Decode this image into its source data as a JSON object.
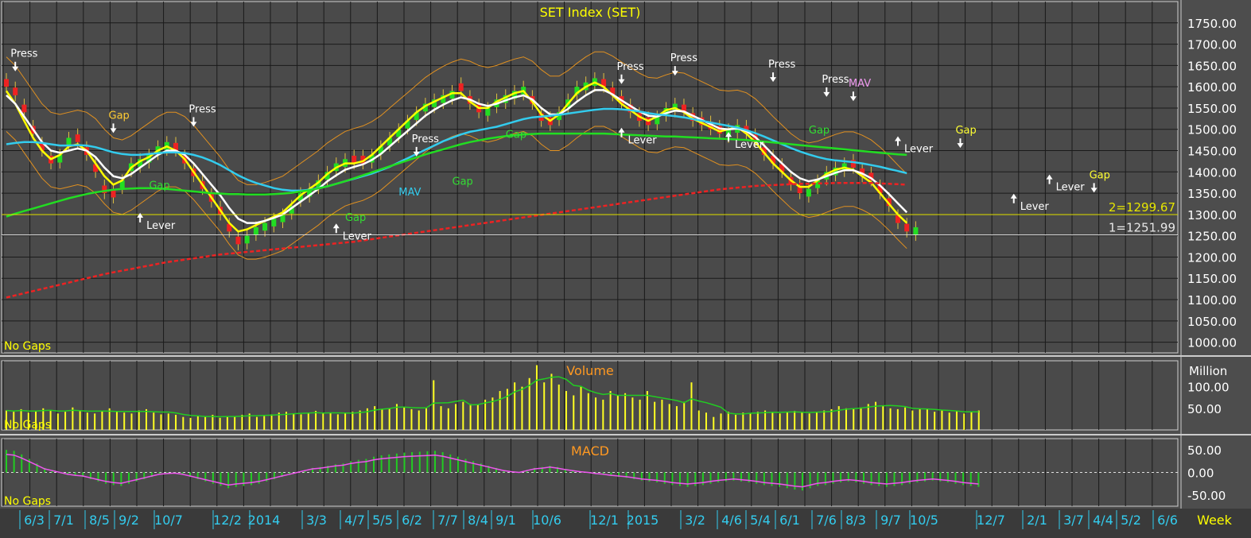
{
  "chart_data": {
    "type": "candlestick",
    "title": "SET Index (SET)",
    "no_gaps_label": "No Gaps",
    "timeframe_label": "Week",
    "x_tick_labels": [
      "6/3",
      "7/1",
      "8/5",
      "9/2",
      "10/7",
      "12/2",
      "2014",
      "3/3",
      "4/7",
      "5/5",
      "6/2",
      "7/7",
      "8/4",
      "9/1",
      "10/6",
      "12/1",
      "2015",
      "3/2",
      "4/6",
      "5/4",
      "6/1",
      "7/6",
      "8/3",
      "9/7",
      "10/5",
      "12/7",
      "2/1",
      "3/7",
      "4/4",
      "5/2",
      "6/6"
    ],
    "price_axis": {
      "ylim": [
        975,
        1800
      ],
      "ticks": [
        "1750.00",
        "1700.00",
        "1650.00",
        "1600.00",
        "1550.00",
        "1500.00",
        "1450.00",
        "1400.00",
        "1350.00",
        "1300.00",
        "1250.00",
        "1200.00",
        "1150.00",
        "1100.00",
        "1050.00",
        "1000.00"
      ]
    },
    "price_lines": [
      {
        "label": "2=1299.67",
        "value": 1299.67,
        "color": "#e6e600"
      },
      {
        "label": "1=1251.99",
        "value": 1251.99,
        "color": "#e8e8e8"
      }
    ],
    "candles_close": [
      1600,
      1580,
      1540,
      1490,
      1450,
      1420,
      1440,
      1480,
      1470,
      1440,
      1400,
      1350,
      1340,
      1380,
      1420,
      1430,
      1440,
      1460,
      1470,
      1450,
      1420,
      1390,
      1360,
      1330,
      1300,
      1260,
      1230,
      1250,
      1270,
      1280,
      1290,
      1300,
      1320,
      1350,
      1360,
      1380,
      1400,
      1420,
      1430,
      1420,
      1420,
      1440,
      1460,
      1480,
      1500,
      1520,
      1540,
      1560,
      1570,
      1580,
      1590,
      1590,
      1560,
      1540,
      1550,
      1570,
      1580,
      1590,
      1600,
      1560,
      1520,
      1510,
      1540,
      1570,
      1600,
      1610,
      1620,
      1600,
      1580,
      1560,
      1540,
      1520,
      1510,
      1530,
      1550,
      1560,
      1540,
      1520,
      1510,
      1500,
      1490,
      1500,
      1510,
      1490,
      1470,
      1440,
      1420,
      1400,
      1370,
      1350,
      1360,
      1380,
      1400,
      1410,
      1420,
      1410,
      1390,
      1380,
      1350,
      1320,
      1280,
      1260,
      1270
    ],
    "candles_direction": [
      -1,
      -1,
      -1,
      -1,
      -1,
      -1,
      1,
      1,
      -1,
      -1,
      -1,
      -1,
      -1,
      1,
      1,
      1,
      1,
      1,
      1,
      -1,
      -1,
      -1,
      -1,
      -1,
      -1,
      -1,
      -1,
      1,
      1,
      1,
      1,
      1,
      1,
      1,
      1,
      1,
      1,
      1,
      1,
      -1,
      -1,
      1,
      1,
      1,
      1,
      1,
      1,
      1,
      1,
      1,
      1,
      -1,
      -1,
      -1,
      1,
      1,
      1,
      1,
      1,
      -1,
      -1,
      -1,
      1,
      1,
      1,
      1,
      1,
      -1,
      -1,
      -1,
      -1,
      -1,
      -1,
      1,
      1,
      1,
      -1,
      -1,
      -1,
      -1,
      -1,
      1,
      1,
      -1,
      -1,
      -1,
      -1,
      -1,
      -1,
      -1,
      1,
      1,
      1,
      1,
      1,
      -1,
      -1,
      -1,
      -1,
      -1,
      -1,
      -1,
      1
    ],
    "series": [
      {
        "name": "",
        "color": "#ffff00",
        "values": [
          1590,
          1560,
          1520,
          1480,
          1450,
          1430,
          1440,
          1460,
          1465,
          1450,
          1420,
          1390,
          1370,
          1380,
          1410,
          1425,
          1435,
          1450,
          1460,
          1450,
          1430,
          1400,
          1370,
          1340,
          1310,
          1280,
          1260,
          1265,
          1275,
          1285,
          1295,
          1305,
          1325,
          1345,
          1360,
          1375,
          1395,
          1410,
          1420,
          1420,
          1425,
          1440,
          1460,
          1480,
          1500,
          1520,
          1540,
          1555,
          1565,
          1575,
          1585,
          1585,
          1565,
          1550,
          1550,
          1565,
          1575,
          1585,
          1590,
          1565,
          1535,
          1520,
          1535,
          1560,
          1585,
          1600,
          1610,
          1600,
          1580,
          1560,
          1545,
          1530,
          1520,
          1530,
          1545,
          1550,
          1540,
          1525,
          1515,
          1505,
          1495,
          1500,
          1505,
          1490,
          1470,
          1445,
          1420,
          1400,
          1380,
          1365,
          1365,
          1380,
          1395,
          1405,
          1410,
          1405,
          1390,
          1375,
          1350,
          1325,
          1300,
          1280
        ]
      },
      {
        "name": "",
        "color": "#ffffff",
        "values": [
          1580,
          1560,
          1530,
          1500,
          1470,
          1450,
          1445,
          1450,
          1455,
          1450,
          1435,
          1410,
          1390,
          1385,
          1395,
          1410,
          1425,
          1440,
          1450,
          1450,
          1440,
          1420,
          1395,
          1370,
          1345,
          1315,
          1290,
          1280,
          1280,
          1285,
          1292,
          1300,
          1315,
          1330,
          1345,
          1360,
          1378,
          1392,
          1405,
          1412,
          1418,
          1428,
          1442,
          1460,
          1478,
          1496,
          1514,
          1532,
          1546,
          1558,
          1568,
          1575,
          1570,
          1560,
          1555,
          1560,
          1568,
          1575,
          1580,
          1570,
          1550,
          1535,
          1535,
          1548,
          1565,
          1580,
          1592,
          1592,
          1582,
          1568,
          1555,
          1542,
          1532,
          1530,
          1538,
          1544,
          1542,
          1532,
          1522,
          1512,
          1502,
          1500,
          1502,
          1496,
          1482,
          1462,
          1440,
          1420,
          1400,
          1385,
          1378,
          1382,
          1390,
          1398,
          1404,
          1404,
          1396,
          1385,
          1368,
          1348,
          1326,
          1305
        ]
      },
      {
        "name": "",
        "color": "#33ccee",
        "values": [
          1465,
          1468,
          1470,
          1470,
          1468,
          1465,
          1462,
          1462,
          1463,
          1462,
          1458,
          1452,
          1446,
          1442,
          1440,
          1440,
          1442,
          1444,
          1446,
          1446,
          1444,
          1440,
          1434,
          1426,
          1416,
          1404,
          1392,
          1382,
          1374,
          1368,
          1362,
          1358,
          1356,
          1356,
          1358,
          1362,
          1366,
          1372,
          1378,
          1384,
          1390,
          1396,
          1404,
          1412,
          1422,
          1432,
          1442,
          1452,
          1462,
          1472,
          1480,
          1488,
          1494,
          1498,
          1502,
          1506,
          1512,
          1518,
          1524,
          1528,
          1530,
          1532,
          1534,
          1537,
          1540,
          1543,
          1546,
          1548,
          1548,
          1547,
          1545,
          1542,
          1538,
          1535,
          1533,
          1531,
          1528,
          1524,
          1520,
          1516,
          1512,
          1508,
          1504,
          1498,
          1491,
          1483,
          1474,
          1465,
          1456,
          1448,
          1441,
          1435,
          1430,
          1427,
          1425,
          1423,
          1420,
          1416,
          1412,
          1407,
          1402,
          1397
        ]
      },
      {
        "name": "",
        "color": "#22dd22",
        "values": [
          1295,
          1302,
          1308,
          1314,
          1320,
          1326,
          1332,
          1338,
          1343,
          1348,
          1352,
          1355,
          1358,
          1360,
          1361,
          1362,
          1362,
          1361,
          1360,
          1358,
          1356,
          1354,
          1352,
          1350,
          1349,
          1348,
          1348,
          1347,
          1347,
          1347,
          1348,
          1349,
          1351,
          1354,
          1357,
          1361,
          1366,
          1372,
          1378,
          1385,
          1392,
          1399,
          1406,
          1413,
          1420,
          1427,
          1434,
          1441,
          1447,
          1453,
          1459,
          1465,
          1470,
          1474,
          1478,
          1481,
          1484,
          1486,
          1488,
          1489,
          1490,
          1490,
          1490,
          1490,
          1490,
          1490,
          1490,
          1490,
          1489,
          1488,
          1487,
          1486,
          1485,
          1484,
          1483,
          1483,
          1482,
          1481,
          1480,
          1479,
          1478,
          1477,
          1476,
          1475,
          1473,
          1471,
          1469,
          1467,
          1465,
          1463,
          1461,
          1459,
          1457,
          1455,
          1453,
          1451,
          1449,
          1447,
          1445,
          1443,
          1441,
          1440
        ]
      },
      {
        "name": "",
        "color": "#ee2222",
        "values": [
          1105,
          1110,
          1115,
          1120,
          1125,
          1130,
          1135,
          1140,
          1145,
          1150,
          1155,
          1160,
          1164,
          1168,
          1172,
          1176,
          1180,
          1184,
          1188,
          1191,
          1194,
          1197,
          1200,
          1203,
          1206,
          1208,
          1210,
          1212,
          1214,
          1216,
          1218,
          1220,
          1222,
          1224,
          1226,
          1228,
          1230,
          1232,
          1234,
          1236,
          1239,
          1242,
          1245,
          1248,
          1251,
          1254,
          1257,
          1260,
          1263,
          1266,
          1269,
          1272,
          1275,
          1278,
          1281,
          1284,
          1287,
          1290,
          1293,
          1296,
          1299,
          1302,
          1305,
          1308,
          1311,
          1314,
          1317,
          1320,
          1323,
          1326,
          1329,
          1332,
          1335,
          1338,
          1341,
          1344,
          1347,
          1350,
          1353,
          1356,
          1359,
          1361,
          1363,
          1365,
          1367,
          1368,
          1369,
          1370,
          1371,
          1372,
          1372,
          1373,
          1373,
          1374,
          1374,
          1374,
          1374,
          1374,
          1373,
          1372,
          1371,
          1370
        ]
      }
    ],
    "annotations": [
      {
        "text": "Press",
        "color": "#ffffff",
        "index": 1,
        "price": 1640,
        "dir": "down"
      },
      {
        "text": "Gap",
        "color": "#ffcc33",
        "index": 12,
        "price": 1495,
        "dir": "down"
      },
      {
        "text": "Press",
        "color": "#ffffff",
        "index": 21,
        "price": 1510,
        "dir": "down"
      },
      {
        "text": "Gap",
        "color": "#33dd33",
        "index": 16,
        "price": 1360,
        "dir": "none"
      },
      {
        "text": "Lever",
        "color": "#ffffff",
        "index": 15,
        "price": 1300,
        "dir": "up"
      },
      {
        "text": "Gap",
        "color": "#33dd33",
        "index": 38,
        "price": 1285,
        "dir": "none"
      },
      {
        "text": "Lever",
        "color": "#ffffff",
        "index": 37,
        "price": 1275,
        "dir": "up"
      },
      {
        "text": "Press",
        "color": "#ffffff",
        "index": 46,
        "price": 1440,
        "dir": "down"
      },
      {
        "text": "MAV",
        "color": "#33ccee",
        "index": 44,
        "price": 1345,
        "dir": "none"
      },
      {
        "text": "Gap",
        "color": "#33dd33",
        "index": 50,
        "price": 1370,
        "dir": "none"
      },
      {
        "text": "Gap",
        "color": "#33dd33",
        "index": 56,
        "price": 1480,
        "dir": "none"
      },
      {
        "text": "Press",
        "color": "#ffffff",
        "index": 69,
        "price": 1610,
        "dir": "down"
      },
      {
        "text": "Lever",
        "color": "#ffffff",
        "index": 69,
        "price": 1500,
        "dir": "up"
      },
      {
        "text": "Press",
        "color": "#ffffff",
        "index": 75,
        "price": 1630,
        "dir": "down"
      },
      {
        "text": "Lever",
        "color": "#ffffff",
        "index": 81,
        "price": 1490,
        "dir": "up"
      },
      {
        "text": "Press",
        "color": "#ffffff",
        "index": 86,
        "price": 1615,
        "dir": "down"
      },
      {
        "text": "Gap",
        "color": "#33dd33",
        "index": 90,
        "price": 1490,
        "dir": "none"
      },
      {
        "text": "Press",
        "color": "#ffffff",
        "index": 92,
        "price": 1580,
        "dir": "down"
      },
      {
        "text": "MAV",
        "color": "#ee99ee",
        "index": 95,
        "price": 1570,
        "dir": "down"
      },
      {
        "text": "Lever",
        "color": "#ffffff",
        "index": 100,
        "price": 1480,
        "dir": "up"
      },
      {
        "text": "Gap",
        "color": "#ffff33",
        "index": 107,
        "price": 1460,
        "dir": "down"
      },
      {
        "text": "Lever",
        "color": "#ffffff",
        "index": 113,
        "price": 1345,
        "dir": "up"
      },
      {
        "text": "Lever",
        "color": "#ffffff",
        "index": 117,
        "price": 1390,
        "dir": "up"
      },
      {
        "text": "Gap",
        "color": "#ffff33",
        "index": 122,
        "price": 1355,
        "dir": "down"
      }
    ],
    "volume": {
      "title": "Volume",
      "unit_label": "Million",
      "ticks": [
        "100.00",
        "50.00"
      ],
      "ylim": [
        0,
        160
      ],
      "values": [
        45,
        42,
        48,
        40,
        44,
        50,
        46,
        38,
        42,
        52,
        45,
        40,
        38,
        44,
        50,
        42,
        40,
        38,
        45,
        48,
        40,
        36,
        38,
        35,
        30,
        28,
        32,
        30,
        35,
        28,
        30,
        32,
        35,
        38,
        30,
        32,
        36,
        40,
        42,
        38,
        36,
        40,
        44,
        38,
        40,
        36,
        38,
        42,
        45,
        50,
        55,
        48,
        50,
        60,
        52,
        48,
        45,
        50,
        115,
        55,
        50,
        60,
        65,
        60,
        58,
        70,
        75,
        90,
        95,
        110,
        100,
        120,
        150,
        110,
        130,
        105,
        90,
        80,
        100,
        85,
        75,
        70,
        90,
        80,
        85,
        75,
        70,
        90,
        65,
        70,
        60,
        55,
        65,
        110,
        45,
        40,
        30,
        38,
        42,
        35,
        40,
        38,
        42,
        45,
        40,
        38,
        42,
        44,
        40,
        38,
        42,
        45,
        48,
        55,
        50,
        48,
        52,
        60,
        65,
        55,
        50,
        48,
        52,
        45,
        50,
        48,
        42,
        45,
        40,
        45,
        38,
        42,
        45
      ]
    },
    "macd": {
      "title": "MACD",
      "ticks": [
        "50.00",
        "0.00",
        "-50.00"
      ],
      "ylim": [
        -75,
        75
      ],
      "values": [
        50,
        48,
        40,
        30,
        20,
        10,
        5,
        0,
        -5,
        -8,
        -10,
        -15,
        -20,
        -25,
        -28,
        -30,
        -25,
        -20,
        -15,
        -10,
        -5,
        -3,
        -2,
        -5,
        -10,
        -15,
        -20,
        -25,
        -30,
        -35,
        -32,
        -30,
        -28,
        -25,
        -20,
        -15,
        -10,
        -5,
        0,
        5,
        10,
        12,
        15,
        18,
        20,
        25,
        28,
        30,
        35,
        38,
        40,
        42,
        44,
        45,
        46,
        47,
        48,
        45,
        40,
        35,
        30,
        25,
        20,
        15,
        10,
        5,
        2,
        0,
        5,
        10,
        12,
        15,
        12,
        8,
        5,
        2,
        0,
        -3,
        -5,
        -8,
        -10,
        -12,
        -15,
        -18,
        -20,
        -22,
        -25,
        -28,
        -30,
        -32,
        -30,
        -28,
        -25,
        -22,
        -20,
        -18,
        -20,
        -22,
        -25,
        -28,
        -30,
        -32,
        -35,
        -38,
        -40,
        -35,
        -30,
        -28,
        -25,
        -22,
        -20,
        -22,
        -25,
        -28,
        -30,
        -32,
        -30,
        -28,
        -25,
        -22,
        -20,
        -18,
        -20,
        -22,
        -25,
        -28,
        -30,
        -32
      ]
    }
  }
}
